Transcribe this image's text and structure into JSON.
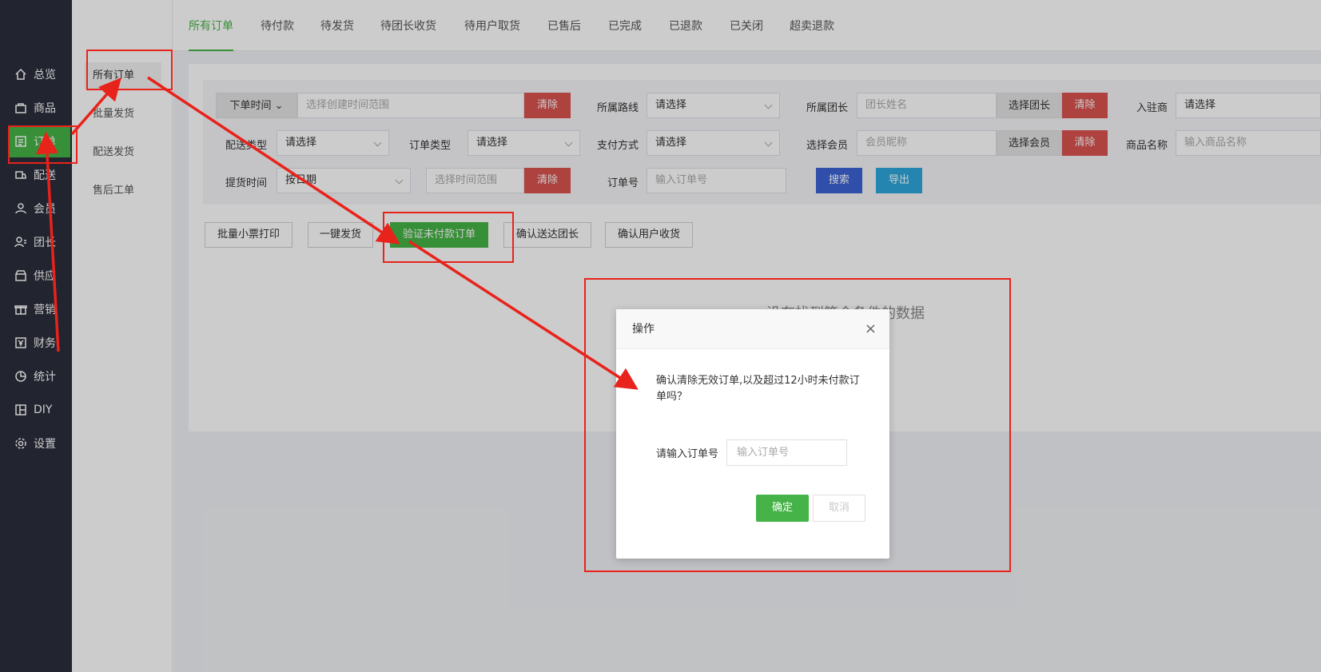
{
  "nav": {
    "items": [
      {
        "label": "总览",
        "icon": "home-icon"
      },
      {
        "label": "商品",
        "icon": "bag-icon"
      },
      {
        "label": "订单",
        "icon": "order-icon",
        "active": true
      },
      {
        "label": "配送",
        "icon": "delivery-icon"
      },
      {
        "label": "会员",
        "icon": "user-icon"
      },
      {
        "label": "团长",
        "icon": "leader-icon"
      },
      {
        "label": "供应",
        "icon": "store-icon"
      },
      {
        "label": "营销",
        "icon": "gift-icon"
      },
      {
        "label": "财务",
        "icon": "finance-icon"
      },
      {
        "label": "统计",
        "icon": "chart-icon"
      },
      {
        "label": "DIY",
        "icon": "layout-icon"
      },
      {
        "label": "设置",
        "icon": "gear-icon"
      }
    ]
  },
  "submenu": {
    "items": [
      "所有订单",
      "批量发货",
      "配送发货",
      "售后工单"
    ]
  },
  "tabs": [
    "所有订单",
    "待付款",
    "待发货",
    "待团长收货",
    "待用户取货",
    "已售后",
    "已完成",
    "已退款",
    "已关闭",
    "超卖退款"
  ],
  "filter": {
    "order_time_label": "下单时间",
    "order_time_placeholder": "选择创建时间范围",
    "clear": "清除",
    "route_label": "所属路线",
    "select_placeholder": "请选择",
    "leader_label": "所属团长",
    "leader_placeholder": "团长姓名",
    "choose_leader": "选择团长",
    "merchant_label": "入驻商",
    "delivery_type_label": "配送类型",
    "order_type_label": "订单类型",
    "pay_method_label": "支付方式",
    "member_label": "选择会员",
    "member_placeholder": "会员昵称",
    "choose_member": "选择会员",
    "product_label": "商品名称",
    "product_placeholder": "输入商品名称",
    "pickup_label": "提货时间",
    "pickup_select": "按日期",
    "pickup_placeholder": "选择时间范围",
    "order_no_label": "订单号",
    "order_no_placeholder": "输入订单号",
    "search": "搜索",
    "export": "导出"
  },
  "actions": [
    "批量小票打印",
    "一键发货",
    "验证未付款订单",
    "确认送达团长",
    "确认用户收货"
  ],
  "empty_text": "没有找到符合条件的数据",
  "modal": {
    "title": "操作",
    "close": "×",
    "message": "确认清除无效订单,以及超过12小时未付款订单吗？",
    "input_label": "请输入订单号",
    "input_placeholder": "输入订单号",
    "ok": "确定",
    "cancel": "取消"
  },
  "colors": {
    "accent": "#45b347",
    "nav_bg": "#2b2d3b",
    "danger": "#d9534f",
    "annotation": "#e8231b"
  }
}
